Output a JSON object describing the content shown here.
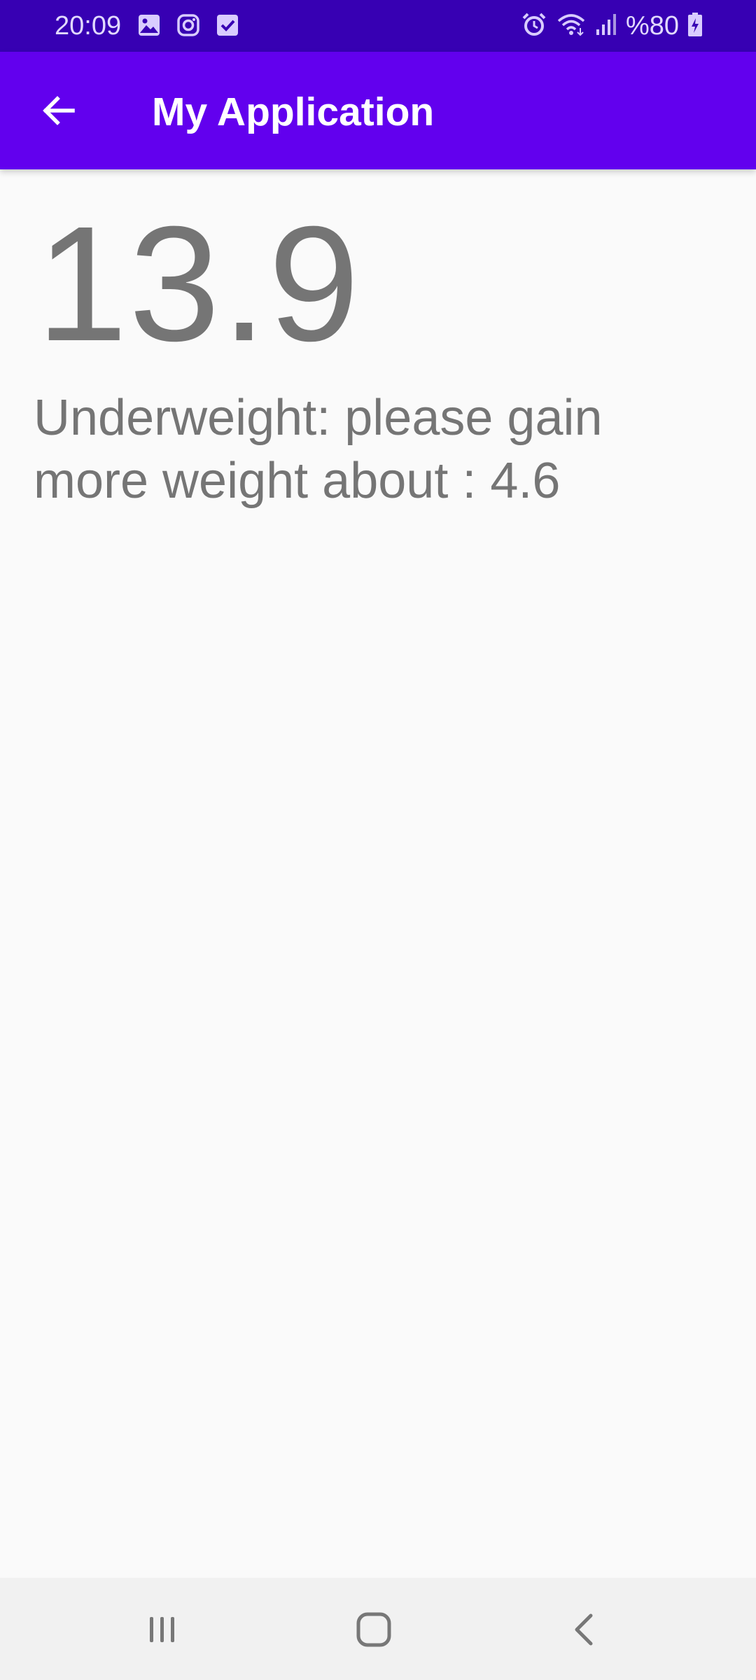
{
  "status_bar": {
    "time": "20:09",
    "battery": "%80",
    "left_icons": [
      "gallery-icon",
      "instagram-icon",
      "checkbox-icon"
    ],
    "right_icons": [
      "alarm-icon",
      "wifi-icon",
      "signal-icon",
      "battery-charging-icon"
    ]
  },
  "app_bar": {
    "title": "My Application",
    "color": "#6200ee"
  },
  "content": {
    "bmi_value": "13.9",
    "message": "Underweight: please gain more weight about : 4.6"
  },
  "nav_bar": {
    "buttons": [
      "recents-icon",
      "home-icon",
      "back-icon"
    ]
  },
  "colors": {
    "status_bar": "#3700b3",
    "app_bar": "#6200ee",
    "text": "#757575",
    "background": "#fafafa"
  }
}
